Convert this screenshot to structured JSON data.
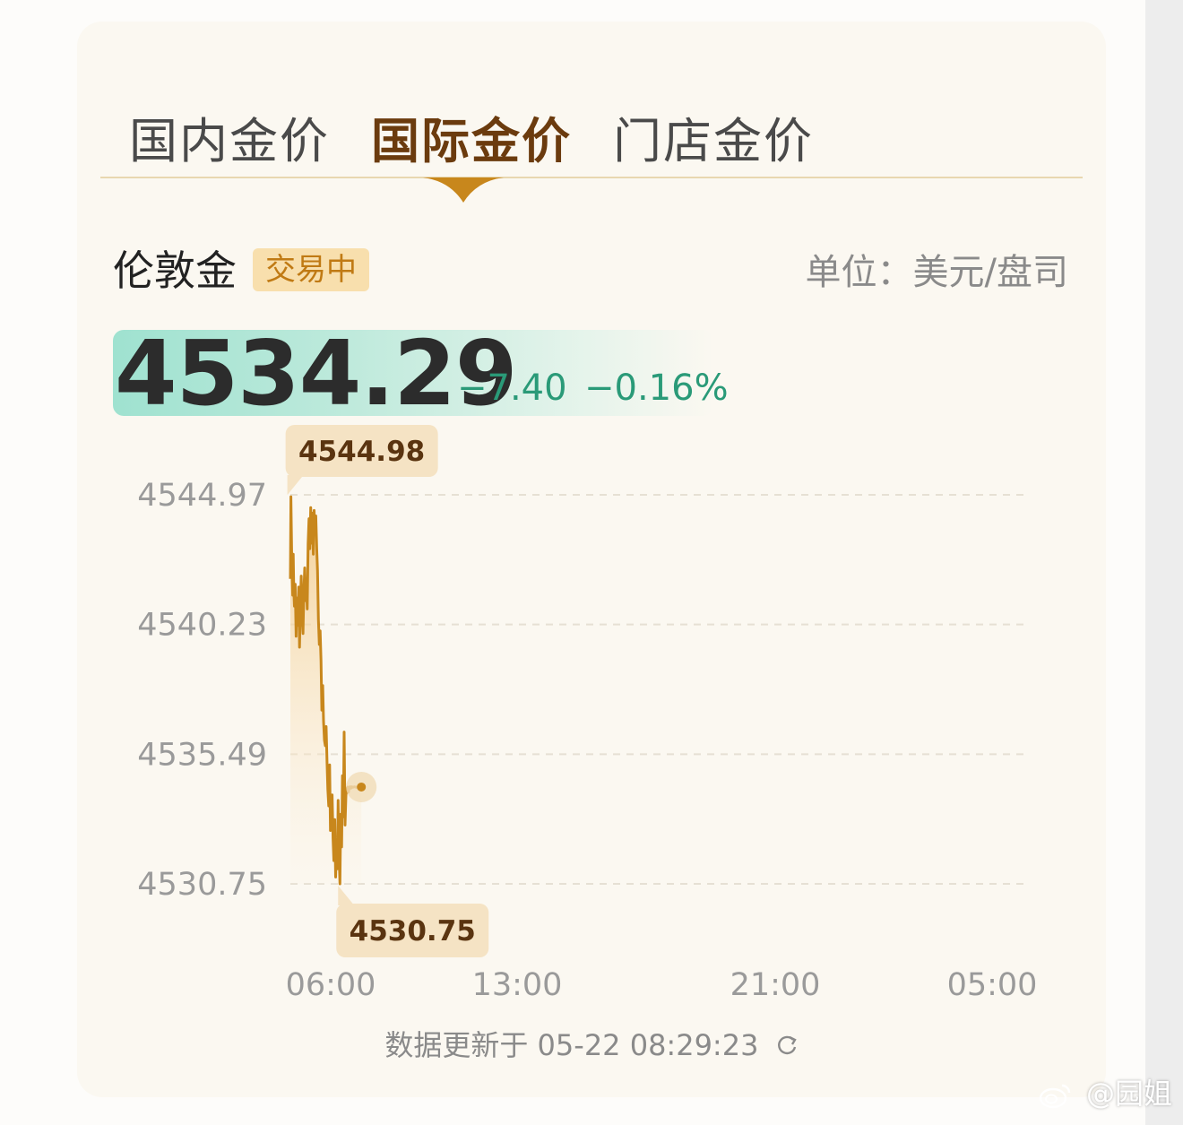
{
  "tabs": [
    {
      "label": "国内金价",
      "active": false
    },
    {
      "label": "国际金价",
      "active": true
    },
    {
      "label": "门店金价",
      "active": false
    }
  ],
  "market": {
    "name": "伦敦金",
    "status": "交易中",
    "unit": "单位：美元/盘司"
  },
  "quote": {
    "price": "4534.29",
    "change": "−7.40",
    "change_pct": "−0.16%"
  },
  "colors": {
    "accent": "#c8871c",
    "up_down_green": "#2a9a78",
    "active_tab": "#6b3b0e"
  },
  "chart_data": {
    "type": "line",
    "ylim": [
      4530.75,
      4544.97
    ],
    "y_ticks": [
      "4544.97",
      "4540.23",
      "4535.49",
      "4530.75"
    ],
    "x_ticks": [
      "06:00",
      "13:00",
      "21:00",
      "05:00"
    ],
    "max_label": "4544.98",
    "min_label": "4530.75",
    "series": [
      {
        "x_hours": [
          4.0,
          4.02,
          4.05,
          4.08,
          4.1,
          4.12,
          4.14,
          4.17,
          4.2,
          4.23,
          4.26,
          4.29,
          4.32,
          4.35,
          4.38,
          4.41,
          4.44,
          4.47,
          4.5,
          4.53,
          4.56,
          4.59,
          4.62,
          4.65,
          4.68,
          4.71,
          4.74,
          4.77,
          4.8,
          4.83,
          4.86,
          4.89,
          4.92,
          4.95,
          4.98,
          5.01,
          5.04,
          5.07,
          5.1,
          5.13,
          5.16,
          5.19,
          5.22,
          5.25,
          5.28,
          5.31,
          5.34,
          5.37,
          5.4,
          5.43,
          5.46,
          5.49,
          5.52,
          5.55,
          5.58,
          5.61,
          5.64,
          5.67,
          5.7,
          5.73,
          5.76,
          5.79,
          5.82,
          5.85,
          5.88,
          5.91,
          5.94,
          5.97,
          6.0,
          6.03,
          6.06,
          6.09,
          6.12,
          6.15,
          6.18,
          6.21,
          6.24,
          6.27,
          6.3,
          6.33,
          6.36,
          6.39,
          6.42,
          6.45,
          6.48
        ],
        "values": [
          4541.9,
          4544.9,
          4542.5,
          4541.3,
          4542.8,
          4541.5,
          4540.9,
          4541.7,
          4539.8,
          4541.2,
          4540.2,
          4541.6,
          4539.4,
          4541.0,
          4542.0,
          4540.6,
          4539.9,
          4541.4,
          4542.3,
          4541.1,
          4541.6,
          4540.8,
          4543.2,
          4544.1,
          4543.0,
          4544.5,
          4543.2,
          4544.3,
          4542.8,
          4544.4,
          4543.6,
          4544.2,
          4543.0,
          4542.2,
          4540.4,
          4539.5,
          4540.0,
          4538.9,
          4537.1,
          4538.0,
          4536.7,
          4536.0,
          4535.8,
          4536.5,
          4535.2,
          4534.2,
          4533.6,
          4535.1,
          4532.7,
          4533.1,
          4534.0,
          4532.4,
          4531.6,
          4533.1,
          4531.0,
          4532.0,
          4531.3,
          4533.8,
          4531.8,
          4530.75,
          4533.3,
          4532.1,
          4534.7,
          4533.2,
          4536.3,
          4532.9,
          4534.0,
          4534.2,
          4534.29,
          4534.1,
          4534.29,
          4534.3,
          4534.25,
          4534.3,
          4534.28,
          4534.29,
          4534.3,
          4534.29,
          4534.28,
          4534.29,
          4534.3,
          4534.29,
          4534.29,
          4534.29,
          4534.29
        ],
        "x_range_hours": [
          4.0,
          29.8
        ]
      }
    ],
    "grid": "dashed horizontal"
  },
  "footer": {
    "update_text": "数据更新于 05-22 08:29:23"
  },
  "watermark": {
    "text": "@园姐"
  }
}
